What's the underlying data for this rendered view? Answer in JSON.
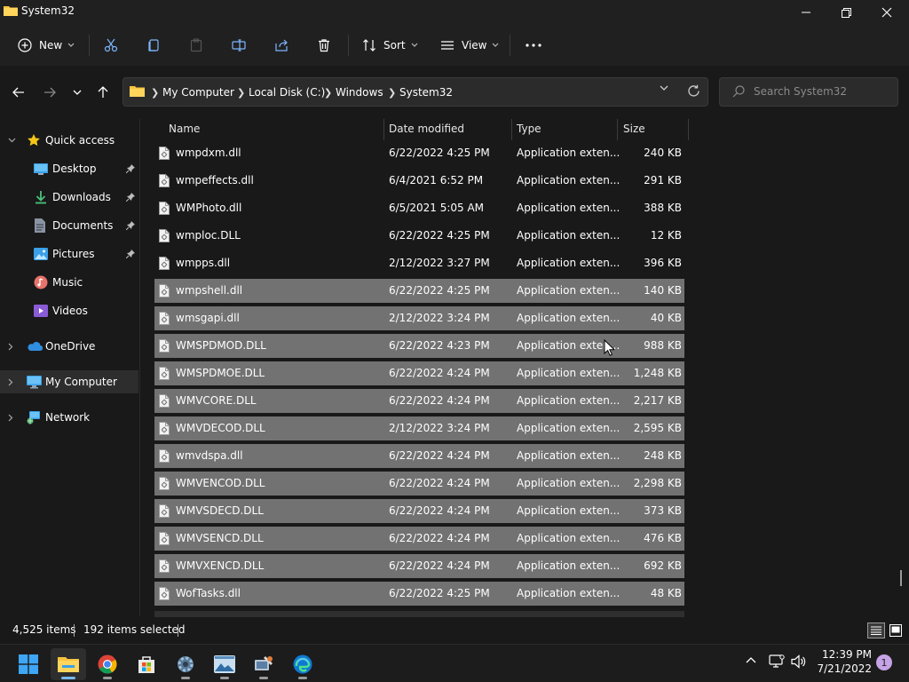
{
  "window": {
    "title": "System32"
  },
  "toolbar": {
    "new_label": "New",
    "sort_label": "Sort",
    "view_label": "View"
  },
  "address": {
    "crumbs": [
      "My Computer",
      "Local Disk (C:)",
      "Windows",
      "System32"
    ]
  },
  "search": {
    "placeholder": "Search System32"
  },
  "nav": {
    "items": [
      {
        "label": "Quick access",
        "icon": "star-icon"
      },
      {
        "label": "Desktop",
        "icon": "desktop-icon"
      },
      {
        "label": "Downloads",
        "icon": "downloads-icon"
      },
      {
        "label": "Documents",
        "icon": "documents-icon"
      },
      {
        "label": "Pictures",
        "icon": "pictures-icon"
      },
      {
        "label": "Music",
        "icon": "music-icon"
      },
      {
        "label": "Videos",
        "icon": "videos-icon"
      },
      {
        "label": "OneDrive",
        "icon": "onedrive-icon"
      },
      {
        "label": "My Computer",
        "icon": "computer-icon"
      },
      {
        "label": "Network",
        "icon": "network-icon"
      }
    ]
  },
  "columns": {
    "name": "Name",
    "date": "Date modified",
    "type": "Type",
    "size": "Size"
  },
  "files": [
    {
      "name": "wmpdxm.dll",
      "date": "6/22/2022 4:25 PM",
      "type": "Application exten...",
      "size": "240 KB",
      "selected": false
    },
    {
      "name": "wmpeffects.dll",
      "date": "6/4/2021 6:52 PM",
      "type": "Application exten...",
      "size": "291 KB",
      "selected": false
    },
    {
      "name": "WMPhoto.dll",
      "date": "6/5/2021 5:05 AM",
      "type": "Application exten...",
      "size": "388 KB",
      "selected": false
    },
    {
      "name": "wmploc.DLL",
      "date": "6/22/2022 4:25 PM",
      "type": "Application exten...",
      "size": "12 KB",
      "selected": false
    },
    {
      "name": "wmpps.dll",
      "date": "2/12/2022 3:27 PM",
      "type": "Application exten...",
      "size": "396 KB",
      "selected": false
    },
    {
      "name": "wmpshell.dll",
      "date": "6/22/2022 4:25 PM",
      "type": "Application exten...",
      "size": "140 KB",
      "selected": true
    },
    {
      "name": "wmsgapi.dll",
      "date": "2/12/2022 3:24 PM",
      "type": "Application exten...",
      "size": "40 KB",
      "selected": true
    },
    {
      "name": "WMSPDMOD.DLL",
      "date": "6/22/2022 4:23 PM",
      "type": "Application exten...",
      "size": "988 KB",
      "selected": true
    },
    {
      "name": "WMSPDMOE.DLL",
      "date": "6/22/2022 4:24 PM",
      "type": "Application exten...",
      "size": "1,248 KB",
      "selected": true
    },
    {
      "name": "WMVCORE.DLL",
      "date": "6/22/2022 4:24 PM",
      "type": "Application exten...",
      "size": "2,217 KB",
      "selected": true
    },
    {
      "name": "WMVDECOD.DLL",
      "date": "2/12/2022 3:24 PM",
      "type": "Application exten...",
      "size": "2,595 KB",
      "selected": true
    },
    {
      "name": "wmvdspa.dll",
      "date": "6/22/2022 4:24 PM",
      "type": "Application exten...",
      "size": "248 KB",
      "selected": true
    },
    {
      "name": "WMVENCOD.DLL",
      "date": "6/22/2022 4:24 PM",
      "type": "Application exten...",
      "size": "2,298 KB",
      "selected": true
    },
    {
      "name": "WMVSDECD.DLL",
      "date": "6/22/2022 4:24 PM",
      "type": "Application exten...",
      "size": "373 KB",
      "selected": true
    },
    {
      "name": "WMVSENCD.DLL",
      "date": "6/22/2022 4:24 PM",
      "type": "Application exten...",
      "size": "476 KB",
      "selected": true
    },
    {
      "name": "WMVXENCD.DLL",
      "date": "6/22/2022 4:24 PM",
      "type": "Application exten...",
      "size": "692 KB",
      "selected": true
    },
    {
      "name": "WofTasks.dll",
      "date": "6/22/2022 4:25 PM",
      "type": "Application exten...",
      "size": "48 KB",
      "selected": true
    }
  ],
  "status": {
    "items_count": "4,525 items",
    "selected_count": "192 items selected"
  },
  "taskbar": {
    "apps": [
      "start-icon",
      "file-explorer-icon",
      "chrome-icon",
      "store-icon",
      "settings-icon",
      "photos-icon",
      "control-panel-icon",
      "edge-icon"
    ],
    "time": "12:39 PM",
    "date": "7/21/2022",
    "notifications": "1"
  },
  "colors": {
    "accent": "#0078d4",
    "selection": "#727272",
    "folder": "#f8c43e"
  }
}
